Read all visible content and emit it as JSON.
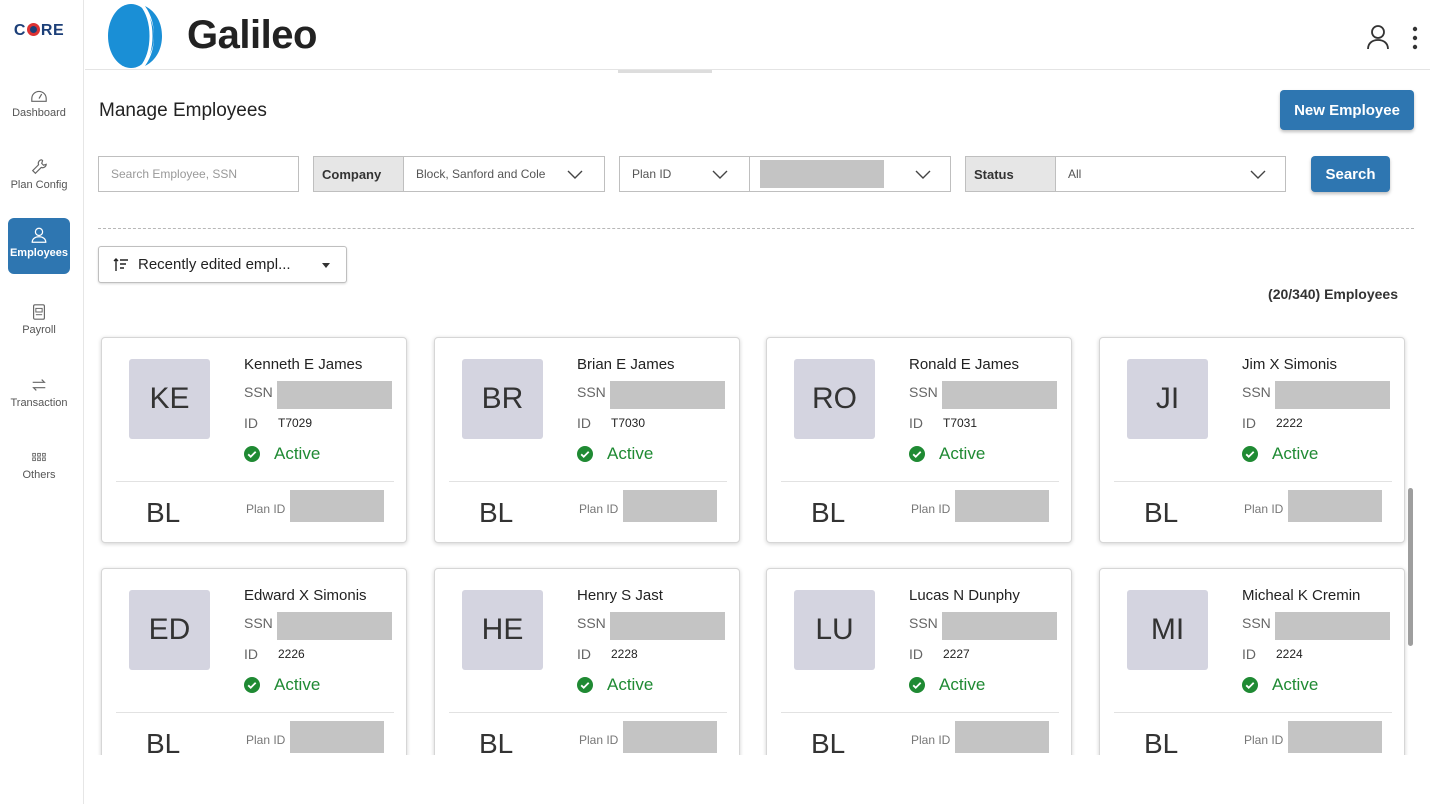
{
  "sidebar": {
    "logo": "C  RE",
    "items": [
      {
        "label": "Dashboard",
        "icon": "dashboard-icon"
      },
      {
        "label": "Plan Config",
        "icon": "wrench-icon"
      },
      {
        "label": "Employees",
        "icon": "user-icon",
        "active": true
      },
      {
        "label": "Payroll",
        "icon": "payroll-icon"
      },
      {
        "label": "Transaction",
        "icon": "transaction-icon"
      },
      {
        "label": "Others",
        "icon": "grid-icon"
      }
    ]
  },
  "header": {
    "brand": "Galileo",
    "user_icon": "user-icon",
    "menu_icon": "kebab-menu-icon"
  },
  "page": {
    "title": "Manage Employees",
    "new_button": "New Employee"
  },
  "filters": {
    "search_placeholder": "Search Employee, SSN",
    "company_label": "Company",
    "company_value": "Block, Sanford and Cole",
    "plan_id_label": "Plan ID",
    "status_label": "Status",
    "status_value": "All",
    "search_button": "Search"
  },
  "sort": {
    "label": "Recently edited empl..."
  },
  "count": "(20/340) Employees",
  "labels": {
    "ssn": "SSN",
    "id": "ID",
    "plan_id": "Plan ID"
  },
  "employees": [
    {
      "initials": "KE",
      "name": "Kenneth E James",
      "id": "T7029",
      "status": "Active",
      "company": "BL"
    },
    {
      "initials": "BR",
      "name": "Brian E James",
      "id": "T7030",
      "status": "Active",
      "company": "BL"
    },
    {
      "initials": "RO",
      "name": "Ronald E James",
      "id": "T7031",
      "status": "Active",
      "company": "BL"
    },
    {
      "initials": "JI",
      "name": "Jim X Simonis",
      "id": "2222",
      "status": "Active",
      "company": "BL"
    },
    {
      "initials": "ED",
      "name": "Edward X Simonis",
      "id": "2226",
      "status": "Active",
      "company": "BL"
    },
    {
      "initials": "HE",
      "name": "Henry S Jast",
      "id": "2228",
      "status": "Active",
      "company": "BL"
    },
    {
      "initials": "LU",
      "name": "Lucas N Dunphy",
      "id": "2227",
      "status": "Active",
      "company": "BL"
    },
    {
      "initials": "MI",
      "name": "Micheal K Cremin",
      "id": "2224",
      "status": "Active",
      "company": "BL"
    }
  ],
  "colors": {
    "accent": "#2e76b1",
    "active_status": "#1f8a33",
    "avatar_bg": "#d4d4e0",
    "redacted": "#c4c4c4"
  }
}
